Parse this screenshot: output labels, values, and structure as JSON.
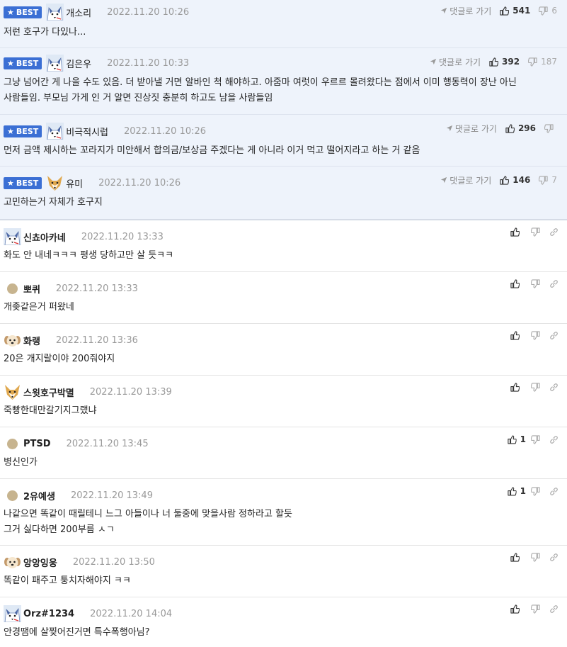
{
  "best_badge": "BEST",
  "reply_label": "댓글로 가기",
  "best": [
    {
      "nick": "개소리",
      "time": "2022.11.20 10:26",
      "text": "저런 호구가 다있나...",
      "up": "541",
      "down": "6"
    },
    {
      "nick": "김은우",
      "time": "2022.11.20 10:33",
      "lines": [
        "그냥 넘어간 게 나을 수도 있음. 더 받아낼 거면 알바인 척 해야하고. 아줌마 여럿이 우르르 몰려왔다는 점에서 이미 행동력이 장난 아닌",
        "사람들임. 부모님 가게 인 거 알면 진상짓 충분히 하고도 남을 사람들임"
      ],
      "up": "392",
      "down": "187"
    },
    {
      "nick": "비극적시럽",
      "time": "2022.11.20 10:26",
      "text": "먼저 금액 제시하는 꼬라지가 미안해서 합의금/보상금 주겠다는 게 아니라 이거 먹고 떨어지라고 하는 거 같음",
      "up": "296",
      "down": ""
    },
    {
      "nick": "유미",
      "time": "2022.11.20 10:26",
      "text": "고민하는거 자체가 호구지",
      "up": "146",
      "down": "7"
    }
  ],
  "comments": [
    {
      "nick": "신쵸아카네",
      "time": "2022.11.20 13:33",
      "text": "화도 안 내네ㅋㅋㅋ 평생 당하고만 살 듯ㅋㅋ",
      "likes": "",
      "avatar": "husky"
    },
    {
      "nick": "뽀퀴",
      "time": "2022.11.20 13:33",
      "text": "개좆같은거 퍼왔네",
      "likes": "",
      "avatar": "dot"
    },
    {
      "nick": "화랭",
      "time": "2022.11.20 13:36",
      "text": "20은 개지랄이야 200줘야지",
      "likes": "",
      "avatar": "puppy"
    },
    {
      "nick": "스윗호구박멸",
      "time": "2022.11.20 13:39",
      "text": "죽빵한대만갈기지그랬냐",
      "likes": "",
      "avatar": "fox"
    },
    {
      "nick": "PTSD",
      "time": "2022.11.20 13:45",
      "text": "병신인가",
      "likes": "1",
      "avatar": "dot"
    },
    {
      "nick": "2유예생",
      "time": "2022.11.20 13:49",
      "lines": [
        "나같으면 똑같이 때릴테니 느그 아들이나 너 둘중에 맞을사람 정하라고 할듯",
        "그거 싫다하면 200부름 ㅅㄱ"
      ],
      "likes": "1",
      "avatar": "dot"
    },
    {
      "nick": "앙앙잉웅",
      "time": "2022.11.20 13:50",
      "text": "똑같이 패주고 퉁치자해야지 ㅋㅋ",
      "likes": "",
      "avatar": "puppy"
    },
    {
      "nick": "Orz#1234",
      "time": "2022.11.20 14:04",
      "text": "안경땜에 살찢어진거면 특수폭행아님?",
      "likes": "",
      "avatar": "husky"
    }
  ]
}
